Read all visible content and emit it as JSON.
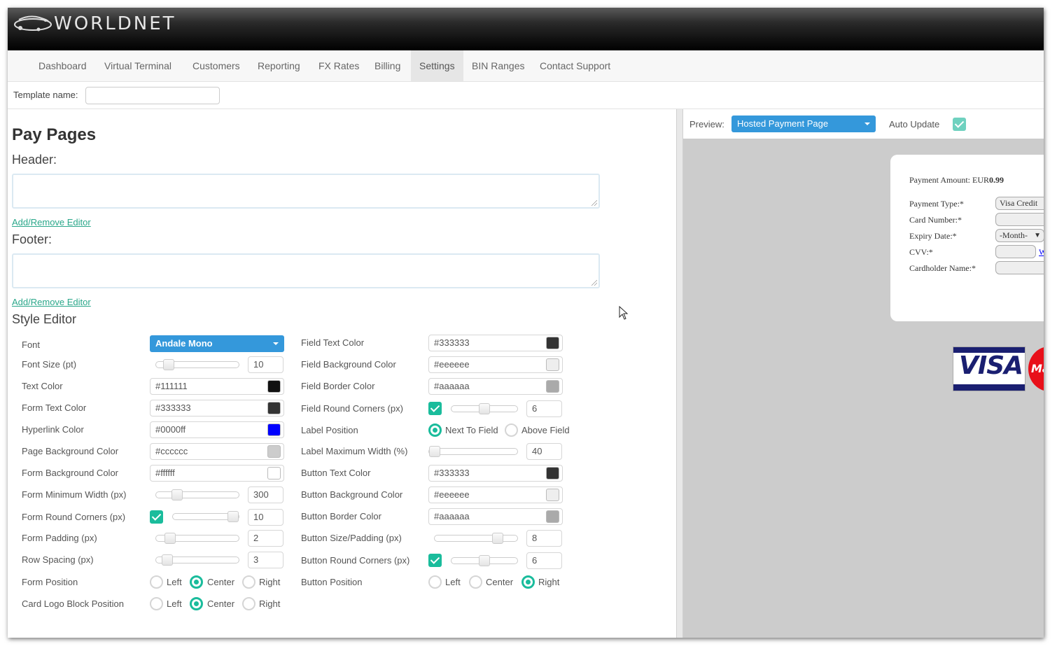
{
  "brand": {
    "name": "WORLDNET"
  },
  "nav": {
    "items": [
      "Dashboard",
      "Virtual Terminal",
      "Customers",
      "Reporting",
      "FX Rates",
      "Billing",
      "Settings",
      "BIN Ranges",
      "Contact Support"
    ],
    "active": "Settings"
  },
  "template": {
    "label": "Template name:",
    "value": ""
  },
  "page": {
    "title": "Pay Pages",
    "header_label": "Header:",
    "footer_label": "Footer:",
    "add_remove_editor": "Add/Remove Editor",
    "style_editor": "Style Editor"
  },
  "style_left": {
    "font": {
      "label": "Font",
      "value": "Andale Mono"
    },
    "font_size": {
      "label": "Font Size (pt)",
      "value": "10"
    },
    "text_color": {
      "label": "Text Color",
      "value": "#111111"
    },
    "form_text_color": {
      "label": "Form Text Color",
      "value": "#333333"
    },
    "hyperlink_color": {
      "label": "Hyperlink Color",
      "value": "#0000ff"
    },
    "page_bg_color": {
      "label": "Page Background Color",
      "value": "#cccccc"
    },
    "form_bg_color": {
      "label": "Form Background Color",
      "value": "#ffffff"
    },
    "form_min_width": {
      "label": "Form Minimum Width (px)",
      "value": "300"
    },
    "form_round_corners": {
      "label": "Form Round Corners (px)",
      "value": "10"
    },
    "form_padding": {
      "label": "Form Padding (px)",
      "value": "2"
    },
    "row_spacing": {
      "label": "Row Spacing (px)",
      "value": "3"
    },
    "form_position": {
      "label": "Form Position",
      "options": [
        "Left",
        "Center",
        "Right"
      ],
      "selected": "Center"
    },
    "card_logo_position": {
      "label": "Card Logo Block Position",
      "options": [
        "Left",
        "Center",
        "Right"
      ],
      "selected": "Center"
    }
  },
  "style_right": {
    "field_text_color": {
      "label": "Field Text Color",
      "value": "#333333"
    },
    "field_bg_color": {
      "label": "Field Background Color",
      "value": "#eeeeee"
    },
    "field_border_color": {
      "label": "Field Border Color",
      "value": "#aaaaaa"
    },
    "field_round_corners": {
      "label": "Field Round Corners (px)",
      "value": "6"
    },
    "label_position": {
      "label": "Label Position",
      "options": [
        "Next To Field",
        "Above Field"
      ],
      "selected": "Next To Field"
    },
    "label_max_width": {
      "label": "Label Maximum Width (%)",
      "value": "40"
    },
    "button_text_color": {
      "label": "Button Text Color",
      "value": "#333333"
    },
    "button_bg_color": {
      "label": "Button Background Color",
      "value": "#eeeeee"
    },
    "button_border_color": {
      "label": "Button Border Color",
      "value": "#aaaaaa"
    },
    "button_size": {
      "label": "Button Size/Padding (px)",
      "value": "8"
    },
    "button_round_corners": {
      "label": "Button Round Corners (px)",
      "value": "6"
    },
    "button_position": {
      "label": "Button Position",
      "options": [
        "Left",
        "Center",
        "Right"
      ],
      "selected": "Right"
    }
  },
  "slider_levels": {
    "font_size": 0.1,
    "form_min_width": 0.22,
    "form_round_corners": 1.0,
    "form_padding": 0.12,
    "row_spacing": 0.08,
    "field_round_corners": 0.5,
    "label_max_width": 0.0,
    "button_size": 0.8,
    "button_round_corners": 0.5
  },
  "preview": {
    "label": "Preview:",
    "page_type": "Hosted Payment Page",
    "auto_update_label": "Auto Update",
    "auto_update": true,
    "payment_amount_label": "Payment Amount: EUR",
    "payment_amount_value": "0.99",
    "payment_type_label": "Payment Type:*",
    "payment_type_value": "Visa Credit",
    "card_number_label": "Card Number:*",
    "expiry_label": "Expiry Date:*",
    "expiry_value": "-Month-",
    "cvv_label": "CVV:*",
    "cvv_link": "W",
    "cardholder_label": "Cardholder Name:*",
    "visa_logo": "VISA",
    "mc_logo": "Ma"
  },
  "colors": {
    "accent": "#1abc9c",
    "dropdown": "#3498db",
    "link": "#2aa78a"
  },
  "icons": [
    "globe-logo-icon",
    "caret-down-icon",
    "checkmark-icon",
    "resize-grip-icon",
    "mouse-cursor-icon"
  ]
}
